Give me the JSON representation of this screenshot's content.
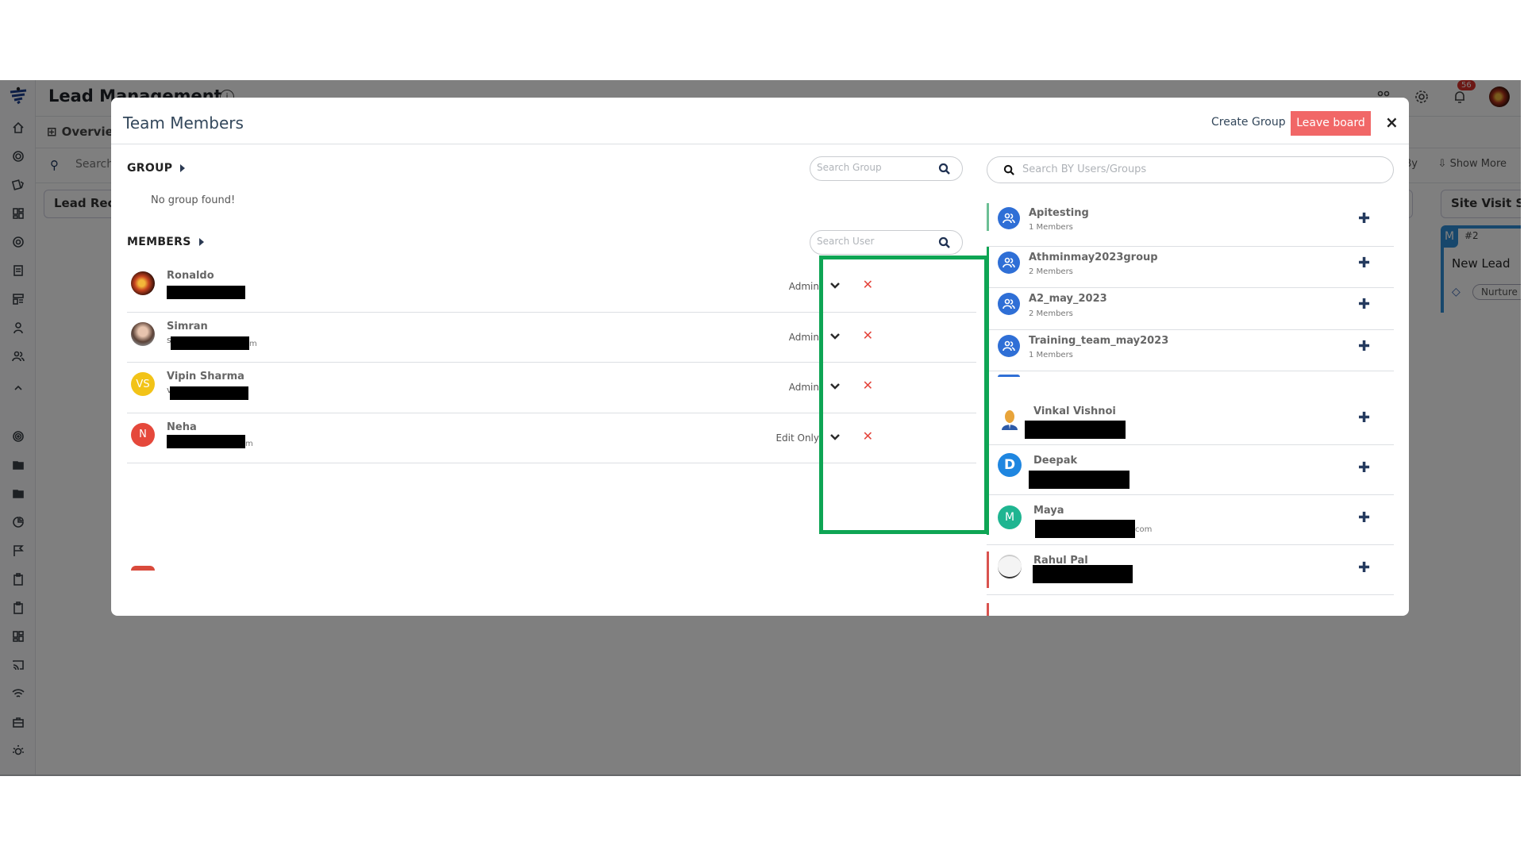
{
  "app": {
    "title": "Lead Management",
    "notification_count": "56",
    "tab_overview": "Overview",
    "search_placeholder": "Search",
    "sort_by_label": "By",
    "show_more_label": "Show More",
    "columns": [
      "Lead Rece",
      "Site Visit Sch"
    ],
    "card": {
      "badge": "M",
      "number": "#2",
      "title": "New Lead",
      "tag": "Nurture L"
    }
  },
  "sidebar": {
    "icons": [
      "logo-icon",
      "home-icon",
      "target-icon",
      "cards-icon",
      "grid-icon",
      "at-icon",
      "document-icon",
      "layout-icon",
      "user-icon",
      "users-icon",
      "chevron-up-icon",
      "radar-icon",
      "folder-icon",
      "folder-icon",
      "pie-icon",
      "flag-icon",
      "clipboard-icon",
      "clipboard-icon",
      "grid-icon",
      "cast-icon",
      "wifi-icon",
      "briefcase-icon",
      "bulb-icon"
    ]
  },
  "modal": {
    "title": "Team Members",
    "create_group_label": "Create Group",
    "leave_board_label": "Leave board",
    "close_label": "×",
    "group_section": {
      "label": "GROUP",
      "search_placeholder": "Search Group",
      "empty_text": "No group found!"
    },
    "members_section": {
      "label": "MEMBERS",
      "search_placeholder": "Search User",
      "members": [
        {
          "name": "Ronaldo",
          "avatar_type": "photo",
          "avatar_initials": "",
          "avatar_color": "#3a0f08",
          "email_visible_prefix": "",
          "email_visible_suffix": "",
          "role": "Admin"
        },
        {
          "name": "Simran",
          "avatar_type": "photo",
          "avatar_initials": "",
          "avatar_color": "#8a7a70",
          "email_visible_prefix": "s",
          "email_visible_suffix": "m",
          "role": "Admin"
        },
        {
          "name": "Vipin Sharma",
          "avatar_type": "initials",
          "avatar_initials": "VS",
          "avatar_color": "#f2c318",
          "email_visible_prefix": "v",
          "email_visible_suffix": "",
          "role": "Admin"
        },
        {
          "name": "Neha",
          "avatar_type": "initials",
          "avatar_initials": "N",
          "avatar_color": "#e5483b",
          "email_visible_prefix": "",
          "email_visible_suffix": "m",
          "role": "Edit Only"
        }
      ]
    },
    "right_panel": {
      "search_placeholder": "Search BY Users/Groups",
      "groups": [
        {
          "name": "Apitesting",
          "members": "1 Members"
        },
        {
          "name": "Athminmay2023group",
          "members": "2 Members"
        },
        {
          "name": "A2_may_2023",
          "members": "2 Members"
        },
        {
          "name": "Training_team_may2023",
          "members": "1 Members"
        }
      ],
      "users": [
        {
          "name": "Vinkal Vishnoi",
          "avatar_type": "person-icon",
          "avatar_initials": "",
          "avatar_color": "#e8a43a",
          "email_visible_suffix": ""
        },
        {
          "name": "Deepak",
          "avatar_type": "initials",
          "avatar_initials": "D",
          "avatar_color": "#1f86e0",
          "email_visible_suffix": ""
        },
        {
          "name": "Maya",
          "avatar_type": "initials",
          "avatar_initials": "M",
          "avatar_color": "#1fb591",
          "email_visible_suffix": "com"
        },
        {
          "name": "Rahul Pal",
          "avatar_type": "photo",
          "avatar_initials": "",
          "avatar_color": "#eeeeee",
          "email_visible_suffix": ""
        }
      ]
    },
    "highlight_color": "#0ea554"
  }
}
